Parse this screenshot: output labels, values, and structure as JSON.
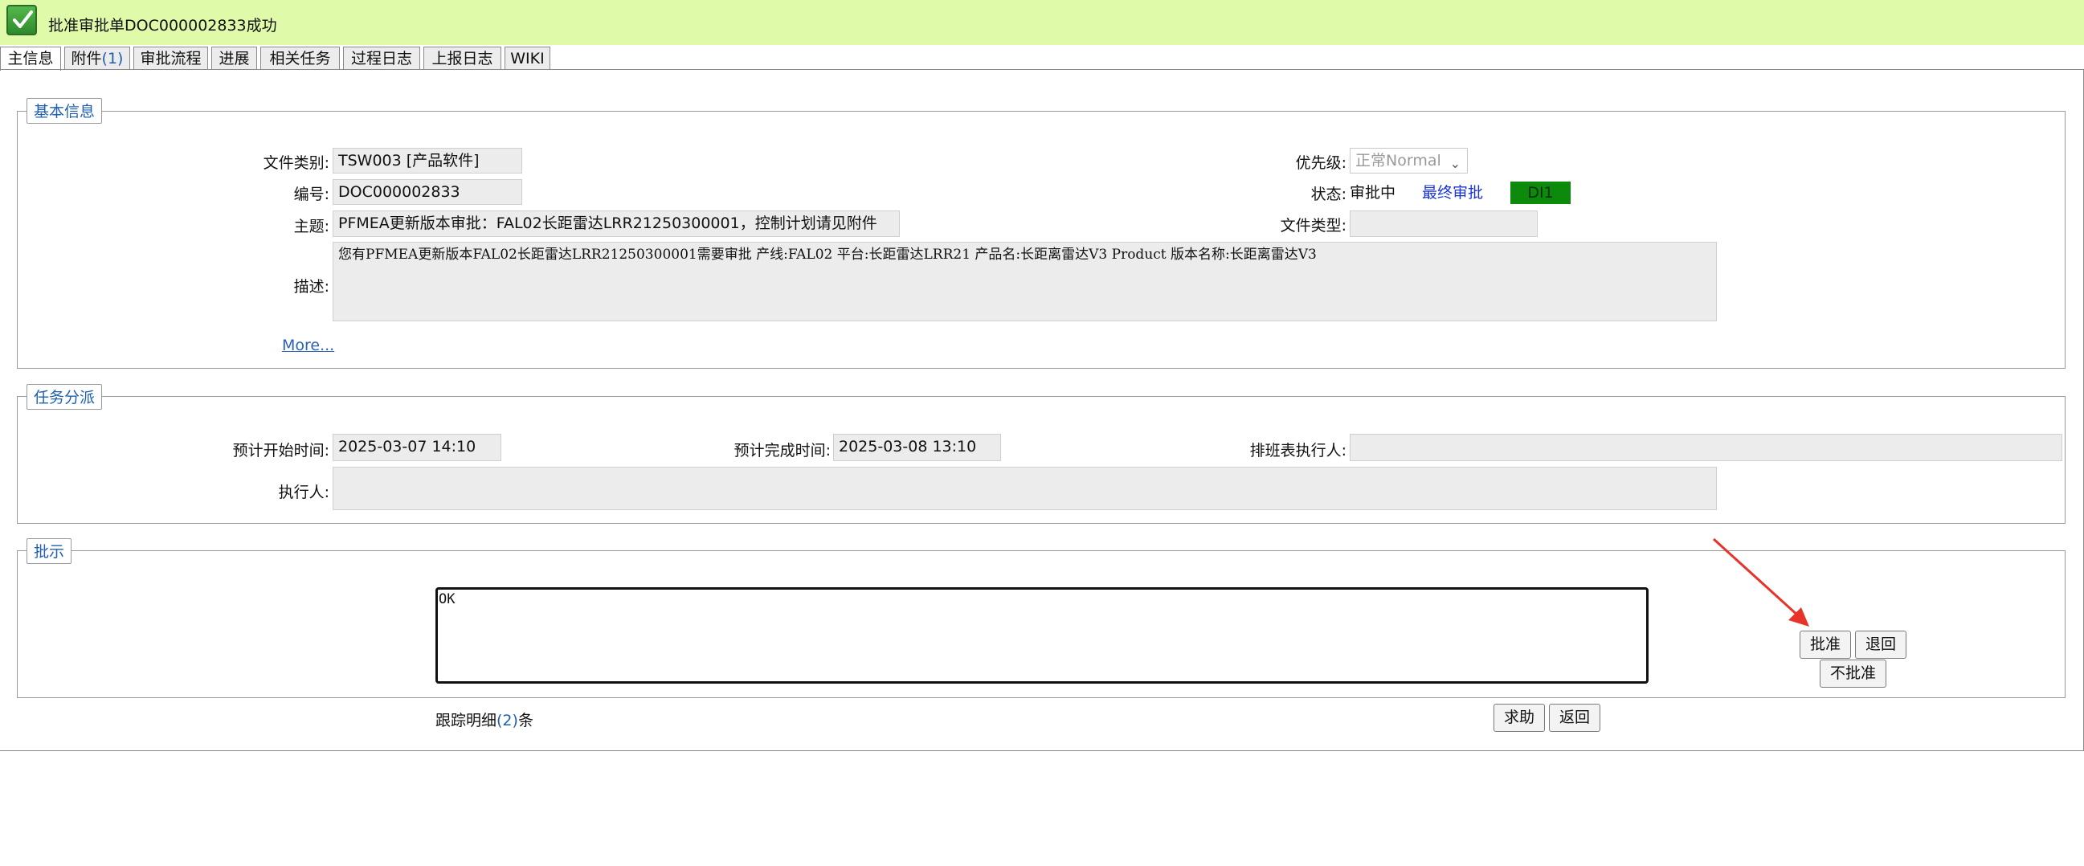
{
  "banner": {
    "message": "批准审批单DOC000002833成功",
    "icon": "check-icon"
  },
  "tabs": [
    {
      "label": "主信息"
    },
    {
      "label": "附件",
      "count": "(1)"
    },
    {
      "label": "审批流程"
    },
    {
      "label": "进展"
    },
    {
      "label": "相关任务"
    },
    {
      "label": "过程日志"
    },
    {
      "label": "上报日志"
    },
    {
      "label": "WIKI"
    }
  ],
  "basic": {
    "legend": "基本信息",
    "doc_category_label": "文件类别:",
    "doc_category_value": "TSW003 [产品软件]",
    "number_label": "编号:",
    "number_value": "DOC000002833",
    "subject_label": "主题:",
    "subject_value": "PFMEA更新版本审批：FAL02长距雷达LRR21250300001，控制计划请见附件",
    "description_label": "描述:",
    "description_value": "您有PFMEA更新版本FAL02长距雷达LRR21250300001需要审批 产线:FAL02 平台:长距雷达LRR21 产品名:长距离雷达V3 Product 版本名称:长距离雷达V3",
    "more_link": "More...",
    "priority_label": "优先级:",
    "priority_value": "正常Normal",
    "status_label": "状态:",
    "status_value": "审批中",
    "final_approval": "最终审批",
    "dl_badge": "DI1",
    "file_type_label": "文件类型:",
    "file_type_value": ""
  },
  "task": {
    "legend": "任务分派",
    "start_label": "预计开始时间:",
    "start_value": "2025-03-07 14:10",
    "end_label": "预计完成时间:",
    "end_value": "2025-03-08 13:10",
    "schedule_exec_label": "排班表执行人:",
    "schedule_exec_value": "",
    "executor_label": "执行人:",
    "executor_value": ""
  },
  "approval": {
    "legend": "批示",
    "comment": "OK",
    "approve_button": "批准",
    "return_button": "退回",
    "reject_button": "不批准"
  },
  "footer": {
    "trace_prefix": "跟踪明细",
    "trace_count": "(2)",
    "trace_suffix": "条",
    "help_button": "求助",
    "back_button": "返回"
  },
  "colors": {
    "banner_bg": "#dffaa8",
    "legend_text": "#1f5fb2",
    "badge_green": "#0c8a0c",
    "annotation_arrow": "#e8332b"
  }
}
